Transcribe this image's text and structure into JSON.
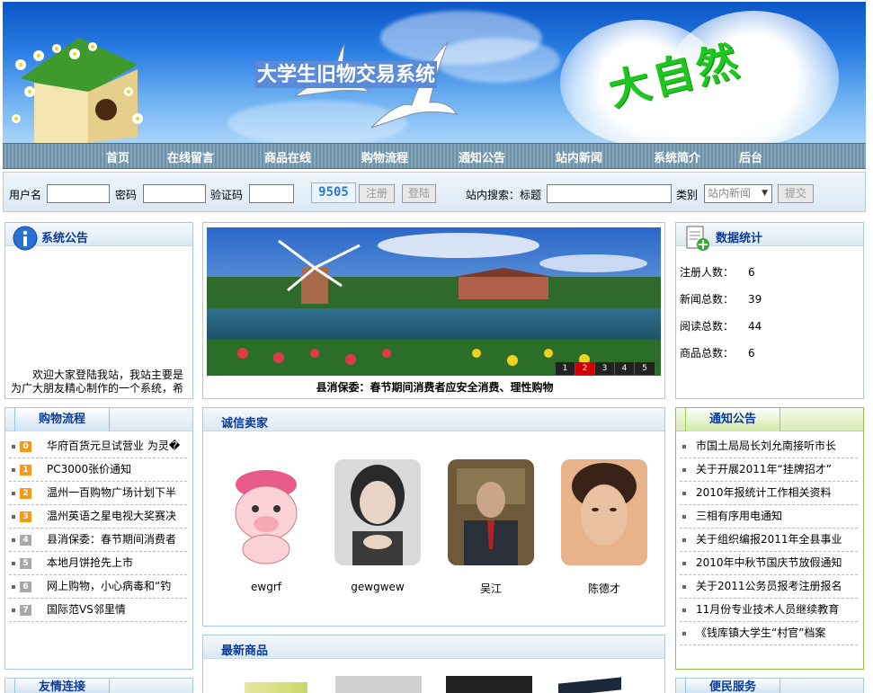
{
  "site_title": "大学生旧物交易系统",
  "banner_slogan": "大自然",
  "nav": [
    "首页",
    "在线留言",
    "商品在线",
    "购物流程",
    "通知公告",
    "站内新闻",
    "系统简介",
    "后台"
  ],
  "login": {
    "username_label": "用户名",
    "password_label": "密码",
    "captcha_label": "验证码",
    "captcha_value": "9505",
    "register_button": "注册",
    "login_button": "登陆",
    "search_label": "站内搜索：标题",
    "category_label": "类别",
    "category_selected": "站内新闻",
    "submit_button": "提交"
  },
  "announcement": {
    "title": "系统公告",
    "text": "欢迎大家登陆我站，我站主要是为广大朋友精心制作的一个系统，希"
  },
  "slideshow": {
    "caption": "县消保委：春节期间消费者应安全消费、理性购物",
    "pages": [
      "1",
      "2",
      "3",
      "4",
      "5"
    ],
    "active_page": "2"
  },
  "stats": {
    "title": "数据统计",
    "rows": [
      {
        "label": "注册人数：",
        "value": "6"
      },
      {
        "label": "新闻总数：",
        "value": "39"
      },
      {
        "label": "阅读总数：",
        "value": "44"
      },
      {
        "label": "商品总数：",
        "value": "6"
      }
    ]
  },
  "shopping_flow": {
    "title": "购物流程",
    "items": [
      {
        "num": "0",
        "text": "华府百货元旦试营业 为灵�"
      },
      {
        "num": "1",
        "text": "PC3000张价通知"
      },
      {
        "num": "2",
        "text": "温州一百购物广场计划下半"
      },
      {
        "num": "3",
        "text": "温州英语之星电视大奖赛决"
      },
      {
        "num": "4",
        "text": "县消保委：春节期间消费者"
      },
      {
        "num": "5",
        "text": "本地月饼抢先上市"
      },
      {
        "num": "6",
        "text": "网上购物，小心病毒和“钓"
      },
      {
        "num": "7",
        "text": "国际范VS邻里情"
      }
    ]
  },
  "sellers": {
    "title": "诚信卖家",
    "items": [
      {
        "name": "ewgrf"
      },
      {
        "name": "gewgwew"
      },
      {
        "name": "吴江"
      },
      {
        "name": "陈德才"
      }
    ]
  },
  "notices": {
    "title": "通知公告",
    "items": [
      "市国土局局长刘允南接听市长",
      "关于开展2011年“挂牌招才”",
      "2010年报统计工作相关资料",
      "三相有序用电通知",
      "关于组织编报2011年全县事业",
      "2010年中秋节国庆节放假通知",
      "关于2011公务员报考注册报名",
      "11月份专业技术人员继续教育",
      "《钱库镇大学生“村官”档案"
    ]
  },
  "new_goods": {
    "title": "最新商品"
  },
  "friend_links": {
    "title": "友情连接"
  },
  "services": {
    "title": "便民服务"
  },
  "colors": {
    "accent": "#0a3a9a",
    "green": "#8dc63f",
    "nav": "#7899b0"
  }
}
